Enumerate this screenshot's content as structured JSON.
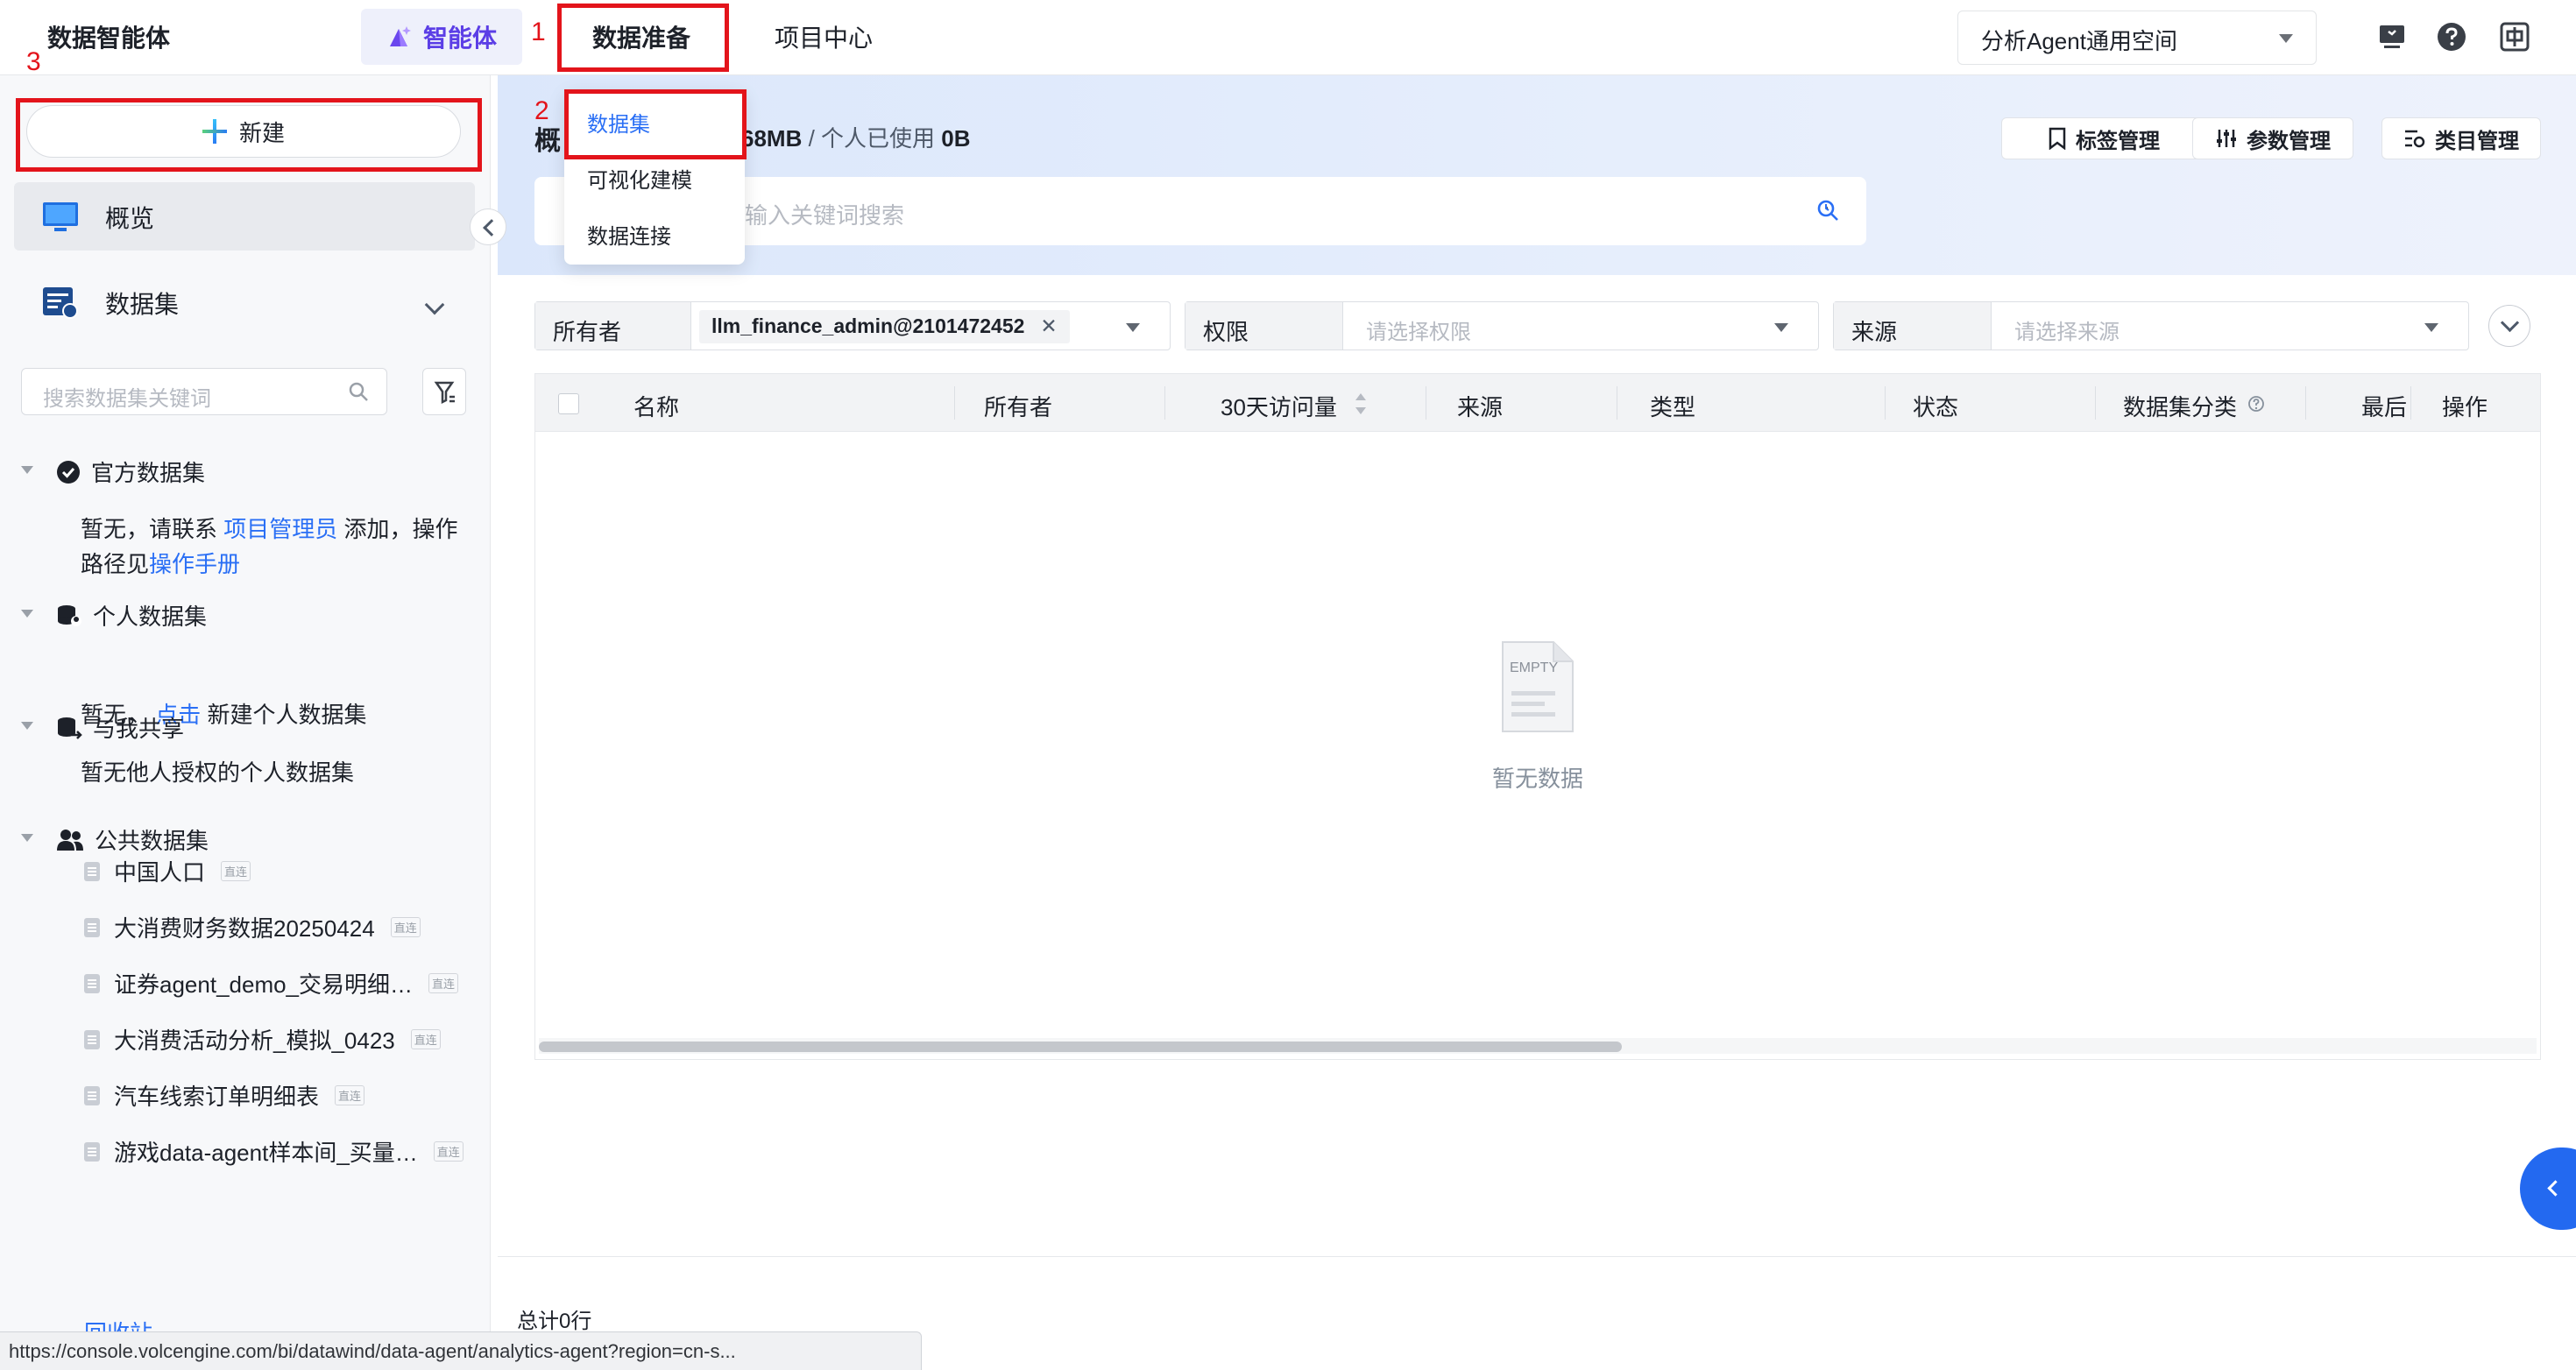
{
  "brand": "数据智能体",
  "nav": {
    "agent_tab": "智能体",
    "dataprep_tab": "数据准备",
    "projects_tab": "项目中心"
  },
  "annotations": {
    "n1": "1",
    "n2": "2",
    "n3": "3"
  },
  "workspace": {
    "selected": "分析Agent通用空间"
  },
  "top_icons": [
    "screen-icon",
    "help-icon",
    "language-icon"
  ],
  "menu": {
    "datasets": "数据集",
    "modeling": "可视化建模",
    "connection": "数据连接"
  },
  "sidebar": {
    "new_label": "新建",
    "overview": "概览",
    "datasets": "数据集",
    "search_placeholder": "搜索数据集关键词",
    "official": {
      "title": "官方数据集",
      "text_a": "暂无，请联系 ",
      "link_a": "项目管理员",
      "text_b": " 添加，操作",
      "text_c": "路径见",
      "link_b": "操作手册"
    },
    "personal": {
      "title": "个人数据集",
      "text_a": "暂无，",
      "link": "点击",
      "text_b": "新建个人数据集"
    },
    "shared": {
      "title": "与我共享",
      "text": "暂无他人授权的个人数据集"
    },
    "public": {
      "title": "公共数据集",
      "badge": "直连",
      "items": [
        "中国人口",
        "大消费财务数据20250424",
        "证券agent_demo_交易明细…",
        "大消费活动分析_模拟_0423",
        "汽车线索订单明细表",
        "游戏data-agent样本间_买量…"
      ]
    },
    "recycle": "回收站"
  },
  "header": {
    "title_char": "概",
    "quota_used_total": "68MB",
    "quota_sep": " / ",
    "quota_personal_label": "个人已使用 ",
    "quota_personal_value": "0B",
    "tag_btn": "标签管理",
    "param_btn": "参数管理",
    "category_btn": "类目管理",
    "search_placeholder": "输入关键词搜索"
  },
  "filters": {
    "owner_label": "所有者",
    "owner_value": "llm_finance_admin@2101472452",
    "perm_label": "权限",
    "perm_placeholder": "请选择权限",
    "source_label": "来源",
    "source_placeholder": "请选择来源"
  },
  "table": {
    "columns": [
      "名称",
      "所有者",
      "30天访问量",
      "来源",
      "类型",
      "状态",
      "数据集分类",
      "最后",
      "操作"
    ],
    "empty_badge": "EMPTY",
    "empty_text": "暂无数据"
  },
  "total": "总计0行",
  "status_url": "https://console.volcengine.com/bi/datawind/data-agent/analytics-agent?region=cn-s...",
  "colors": {
    "accent": "#2a6ff5",
    "highlight": "#e3141b",
    "agent": "#5b3ee6"
  }
}
